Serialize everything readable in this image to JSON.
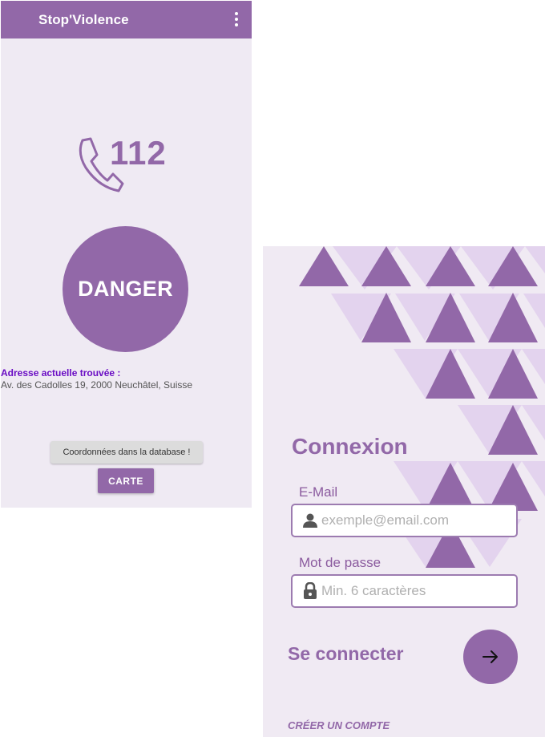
{
  "colors": {
    "primary": "#9268a8",
    "light_triangle": "#e3d3ee",
    "background": "#efeaf3",
    "address_label": "#6a0dc4"
  },
  "home": {
    "app_title": "Stop'Violence",
    "menu_icon": "more-vert-icon",
    "phone_icon": "phone-icon",
    "emergency_number": "112",
    "danger_label": "DANGER",
    "address_label": "Adresse actuelle trouvée :",
    "address_value": "Av. des Cadolles 19, 2000 Neuchâtel, Suisse",
    "database_button": "Coordonnées dans la database !",
    "map_button": "CARTE"
  },
  "login": {
    "title": "Connexion",
    "email_label": "E-Mail",
    "email_placeholder": "exemple@email.com",
    "email_icon": "person-icon",
    "password_label": "Mot de passe",
    "password_placeholder": "Min. 6 caractères",
    "password_icon": "lock-icon",
    "connect_label": "Se connecter",
    "submit_icon": "arrow-right-icon",
    "create_account": "CRÉER UN COMPTE"
  }
}
